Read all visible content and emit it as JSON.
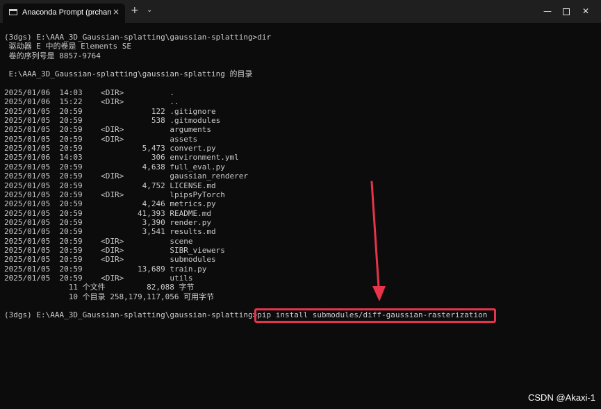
{
  "window": {
    "tab_title": "Anaconda Prompt (prcharm) -",
    "tab_close": "×",
    "new_tab": "+",
    "dropdown": "⌄",
    "minimize": "—",
    "close": "✕"
  },
  "terminal": {
    "lines": [
      "(3dgs) E:\\AAA_3D_Gaussian-splatting\\gaussian-splatting>dir",
      " 驱动器 E 中的卷是 Elements SE",
      " 卷的序列号是 8857-9764",
      "",
      " E:\\AAA_3D_Gaussian-splatting\\gaussian-splatting 的目录",
      "",
      "2025/01/06  14:03    <DIR>          .",
      "2025/01/06  15:22    <DIR>          ..",
      "2025/01/05  20:59               122 .gitignore",
      "2025/01/05  20:59               538 .gitmodules",
      "2025/01/05  20:59    <DIR>          arguments",
      "2025/01/05  20:59    <DIR>          assets",
      "2025/01/05  20:59             5,473 convert.py",
      "2025/01/06  14:03               306 environment.yml",
      "2025/01/05  20:59             4,638 full_eval.py",
      "2025/01/05  20:59    <DIR>          gaussian_renderer",
      "2025/01/05  20:59             4,752 LICENSE.md",
      "2025/01/05  20:59    <DIR>          lpipsPyTorch",
      "2025/01/05  20:59             4,246 metrics.py",
      "2025/01/05  20:59            41,393 README.md",
      "2025/01/05  20:59             3,390 render.py",
      "2025/01/05  20:59             3,541 results.md",
      "2025/01/05  20:59    <DIR>          scene",
      "2025/01/05  20:59    <DIR>          SIBR_viewers",
      "2025/01/05  20:59    <DIR>          submodules",
      "2025/01/05  20:59            13,689 train.py",
      "2025/01/05  20:59    <DIR>          utils",
      "              11 个文件         82,088 字节",
      "              10 个目录 258,179,117,056 可用字节",
      "",
      "(3dgs) E:\\AAA_3D_Gaussian-splatting\\gaussian-splatting>pip install submodules/diff-gaussian-rasterization"
    ]
  },
  "annotation": {
    "color": "#e8334a"
  },
  "watermark": "CSDN @Akaxi-1"
}
